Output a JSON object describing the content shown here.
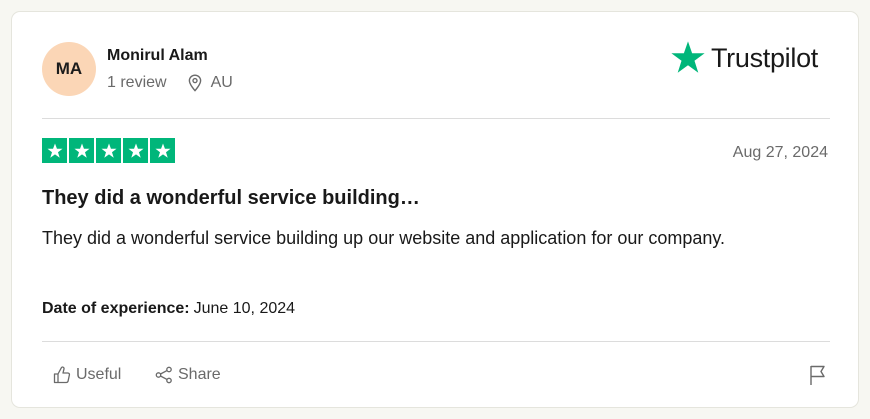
{
  "reviewer": {
    "initials": "MA",
    "name": "Monirul Alam",
    "review_count": "1 review",
    "country": "AU"
  },
  "brand": {
    "name": "Trustpilot"
  },
  "review": {
    "rating": 5,
    "rating_max": 5,
    "date": "Aug 27, 2024",
    "title": "They did a wonderful service building…",
    "body": "They did a wonderful service building up our website and application for our company.",
    "experience_label": "Date of experience:",
    "experience_date": "June 10, 2024"
  },
  "actions": {
    "useful": "Useful",
    "share": "Share"
  },
  "icons": {
    "brand": "star-icon",
    "location": "location-pin-icon",
    "useful": "thumbs-up-icon",
    "share": "share-icon",
    "report": "flag-icon"
  },
  "colors": {
    "star_green": "#00b67a",
    "avatar_bg": "#fbd6b6"
  }
}
